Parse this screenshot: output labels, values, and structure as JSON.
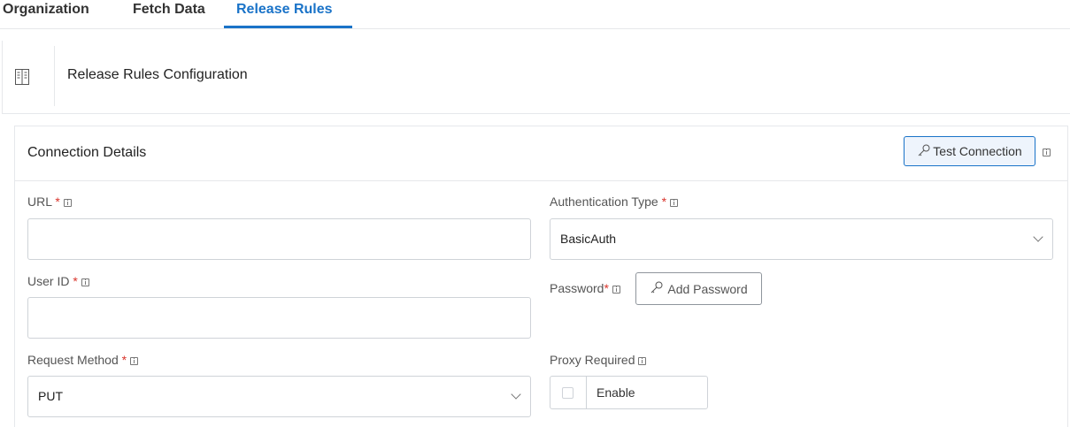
{
  "tabs": [
    {
      "label": "Organization"
    },
    {
      "label": "Fetch Data"
    },
    {
      "label": "Release Rules",
      "active": true
    }
  ],
  "header": {
    "icon": "book-icon",
    "title": "Release Rules Configuration"
  },
  "connection": {
    "title": "Connection Details",
    "test_button": "Test Connection",
    "fields": {
      "url": {
        "label": "URL",
        "required_mark": "*",
        "value": ""
      },
      "user_id": {
        "label": "User ID",
        "required_mark": "*",
        "value": ""
      },
      "request_method": {
        "label": "Request Method",
        "required_mark": "*",
        "value": "PUT"
      },
      "auth_type": {
        "label": "Authentication Type",
        "required_mark": "*",
        "value": "BasicAuth"
      },
      "password": {
        "label": "Password",
        "required_mark": "*",
        "button": "Add Password"
      },
      "proxy": {
        "label": "Proxy Required",
        "toggle_label": "Enable",
        "checked": false
      }
    }
  },
  "colors": {
    "accent": "#1a73c8",
    "required": "#d9342b",
    "border": "#cfd3d8"
  }
}
